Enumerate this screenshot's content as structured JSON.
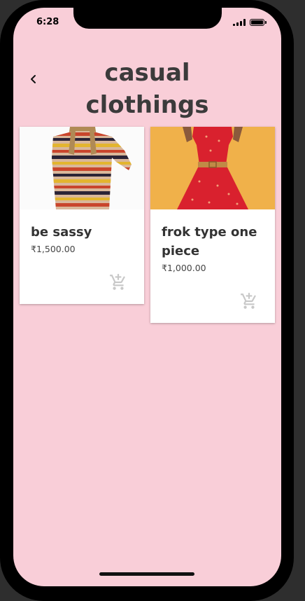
{
  "status_bar": {
    "time": "6:28"
  },
  "header": {
    "title_line1": "casual",
    "title_line2": "clothings",
    "back_icon": "chevron-left-icon"
  },
  "products": [
    {
      "name": "be sassy",
      "price": "₹1,500.00",
      "image": "striped-sweater-photo",
      "cart_icon": "add-shopping-cart-icon"
    },
    {
      "name": "frok type one piece",
      "price": "₹1,000.00",
      "image": "red-dress-photo",
      "cart_icon": "add-shopping-cart-icon"
    }
  ],
  "colors": {
    "background": "#f9ced8",
    "card": "#ffffff",
    "title": "#3b3b3b",
    "icon_muted": "#c8c8c8"
  }
}
